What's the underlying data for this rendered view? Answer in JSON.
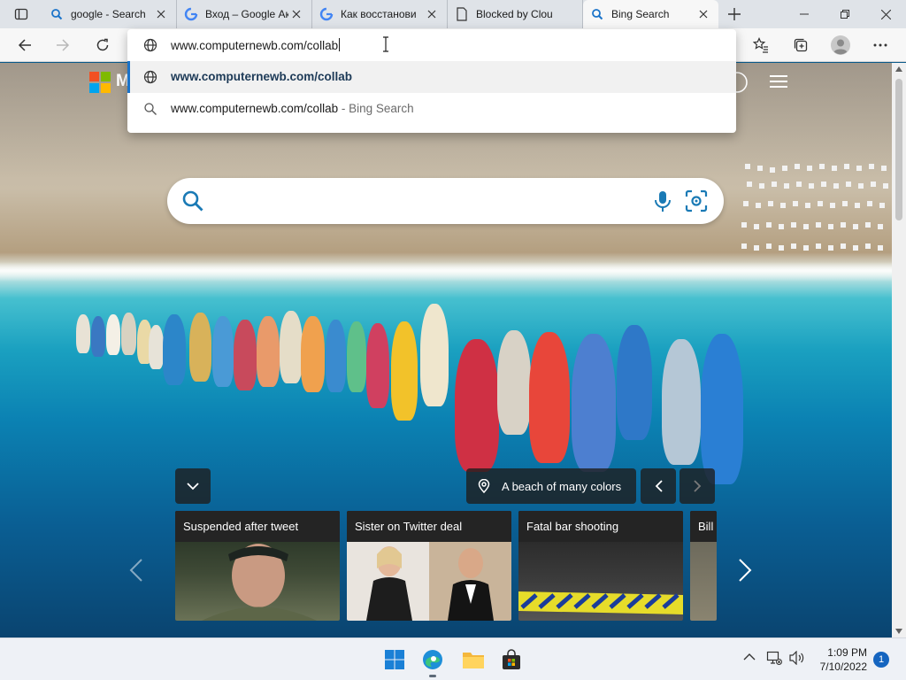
{
  "browser": {
    "tabs": [
      {
        "title": "google - Search",
        "icon": "bing-search-icon"
      },
      {
        "title": "Вход – Google Ак",
        "icon": "google-g-icon"
      },
      {
        "title": "Как восстанови",
        "icon": "google-g-icon"
      },
      {
        "title": "Blocked by Clou",
        "icon": "page-icon"
      },
      {
        "title": "Bing Search",
        "icon": "bing-search-icon",
        "active": true
      }
    ],
    "address": {
      "typed": "www.computernewb.com/collab",
      "suggestions": [
        {
          "text": "www.computernewb.com/collab",
          "suffix": "",
          "icon": "globe-icon",
          "selected": true
        },
        {
          "text": "www.computernewb.com/collab",
          "suffix": " - Bing Search",
          "icon": "search-icon",
          "selected": false
        }
      ]
    }
  },
  "bing": {
    "brand_initial": "M",
    "image_caption": "A beach of many colors",
    "news_cards": [
      {
        "title": "Suspended after tweet"
      },
      {
        "title": "Sister on Twitter deal"
      },
      {
        "title": "Fatal bar shooting"
      },
      {
        "title": "Bill"
      }
    ]
  },
  "taskbar": {
    "time": "1:09 PM",
    "date": "7/10/2022",
    "notifications": "1"
  },
  "colors": {
    "accent": "#1a73c9",
    "ms_red": "#f25022",
    "ms_green": "#7fba00",
    "ms_blue": "#00a4ef",
    "ms_yellow": "#ffb900"
  }
}
